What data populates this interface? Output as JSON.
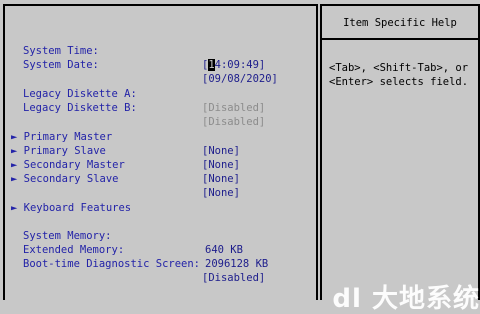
{
  "colors": {
    "background": "#c8c8c8",
    "label": "#2323a8",
    "value": "#1d1d8c",
    "disabled_value": "#8c8c8c",
    "border": "#000000"
  },
  "settings": [
    {
      "label": "System Time:",
      "value_cursor": "1",
      "value_rest": "4:09:49",
      "prefix": "[",
      "suffix": "]"
    },
    {
      "label": "System Date:",
      "value": "[09/08/2020]"
    },
    {
      "label": "Legacy Diskette A:",
      "value": "[Disabled]"
    },
    {
      "label": "Legacy Diskette B:",
      "value": "[Disabled]"
    },
    {
      "label": "Primary Master",
      "value": "[None]"
    },
    {
      "label": "Primary Slave",
      "value": "[None]"
    },
    {
      "label": "Secondary Master",
      "value": "[None]"
    },
    {
      "label": "Secondary Slave",
      "value": "[None]"
    },
    {
      "label": "Keyboard Features"
    },
    {
      "label": "System Memory:",
      "value": "640 KB"
    },
    {
      "label": "Extended Memory:",
      "value": "2096128 KB"
    },
    {
      "label": "Boot-time Diagnostic Screen:",
      "value": "[Disabled]"
    }
  ],
  "submenu_arrow": "►",
  "help": {
    "title": "Item Specific Help",
    "text": "<Tab>, <Shift-Tab>, or\n<Enter> selects field."
  },
  "watermark": "dl 大地系统"
}
